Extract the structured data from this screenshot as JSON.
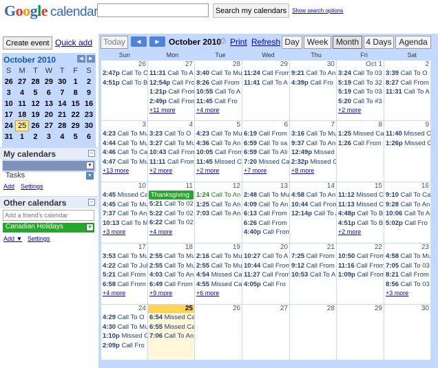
{
  "header": {
    "logo_google": "Google",
    "logo_calendar": "calendar",
    "search_placeholder": "",
    "search_button": "Search my calendars",
    "search_options": "Show search options"
  },
  "sidebar": {
    "create_event": "Create event",
    "quick_add": "Quick add",
    "mini_month": "October 2010",
    "weekday_headers": [
      "S",
      "M",
      "T",
      "W",
      "T",
      "F",
      "S"
    ],
    "mini_weeks": [
      [
        "26",
        "27",
        "28",
        "29",
        "30",
        "1",
        "2"
      ],
      [
        "3",
        "4",
        "5",
        "6",
        "7",
        "8",
        "9"
      ],
      [
        "10",
        "11",
        "12",
        "13",
        "14",
        "15",
        "16"
      ],
      [
        "17",
        "18",
        "19",
        "20",
        "21",
        "22",
        "23"
      ],
      [
        "24",
        "25",
        "26",
        "27",
        "28",
        "29",
        "30"
      ],
      [
        "31",
        "1",
        "2",
        "3",
        "4",
        "5",
        "6"
      ]
    ],
    "my_calendars_title": "My calendars",
    "tasks_label": "Tasks",
    "add_link": "Add",
    "settings_link": "Settings",
    "other_calendars_title": "Other calendars",
    "friend_placeholder": "Add a friend's calendar",
    "canadian_holidays": "Canadian Holidays",
    "add_menu_link": "Add ▼",
    "settings_link2": "Settings",
    "colors": {
      "holiday": "#28a52d",
      "mycal": "#7f93b8"
    }
  },
  "toolbar": {
    "today": "Today",
    "prev_icon": "◀",
    "next_icon": "▶",
    "current_month": "October 2010",
    "print": "Print",
    "refresh": "Refresh",
    "views": [
      "Day",
      "Week",
      "Month",
      "4 Days",
      "Agenda"
    ],
    "selected_view": "Month"
  },
  "grid": {
    "days_of_week": [
      "Sun",
      "Mon",
      "Tue",
      "Wed",
      "Thu",
      "Fri",
      "Sat"
    ],
    "weeks": [
      [
        {
          "day": "26",
          "events": [
            {
              "t": "2:47p",
              "x": "Call To O"
            },
            {
              "t": "4:51p",
              "x": "Call To B"
            }
          ]
        },
        {
          "day": "27",
          "events": [
            {
              "t": "11:31",
              "x": "Call To A"
            },
            {
              "t": "12:54p",
              "x": "Call Fro"
            },
            {
              "t": "1:21p",
              "x": "Call From"
            },
            {
              "t": "2:49p",
              "x": "Call From"
            }
          ],
          "more": "+11 more"
        },
        {
          "day": "28",
          "events": [
            {
              "t": "3:40",
              "x": "Call To Mu"
            },
            {
              "t": "8:26",
              "x": "Call From"
            },
            {
              "t": "10:55",
              "x": "Call To A"
            },
            {
              "t": "11:45",
              "x": "Call Fro"
            }
          ],
          "more": "+4 more"
        },
        {
          "day": "29",
          "events": [
            {
              "t": "11:24",
              "x": "Call From"
            },
            {
              "t": "11:41",
              "x": "Call To A"
            }
          ]
        },
        {
          "day": "30",
          "events": [
            {
              "t": "9:21",
              "x": "Call To An"
            },
            {
              "t": "4:39p",
              "x": "Call Fro"
            }
          ]
        },
        {
          "day": "Oct 1",
          "events": [
            {
              "t": "3:24",
              "x": "Call To 03"
            },
            {
              "t": "5:19",
              "x": "Call To 32"
            },
            {
              "t": "5:19",
              "x": "Call To 03"
            },
            {
              "t": "5:20",
              "x": "Call To #3"
            }
          ],
          "more": "+2 more"
        },
        {
          "day": "2",
          "events": [
            {
              "t": "3:39",
              "x": "Call To O"
            },
            {
              "t": "8:27",
              "x": "Call From"
            },
            {
              "t": "11:31",
              "x": "Call To A"
            }
          ]
        }
      ],
      [
        {
          "day": "3",
          "events": [
            {
              "t": "4:23",
              "x": "Call To Mu"
            },
            {
              "t": "4:44",
              "x": "Call To Mu"
            },
            {
              "t": "4:46",
              "x": "Call To Ca"
            },
            {
              "t": "4:47",
              "x": "Call To Mu"
            }
          ],
          "more": "+13 more"
        },
        {
          "day": "4",
          "events": [
            {
              "t": "3:23",
              "x": "Call To O"
            },
            {
              "t": "3:27",
              "x": "Call To Mu"
            },
            {
              "t": "10:43",
              "x": "Call From"
            },
            {
              "t": "11:11",
              "x": "Call From"
            }
          ],
          "more": "+2 more"
        },
        {
          "day": "5",
          "events": [
            {
              "t": "4:23",
              "x": "Call To Mu"
            },
            {
              "t": "4:36",
              "x": "Call To An"
            },
            {
              "t": "10:05",
              "x": "Call From"
            },
            {
              "t": "11:45",
              "x": "Missed Ca"
            }
          ],
          "more": "+2 more"
        },
        {
          "day": "6",
          "events": [
            {
              "t": "6:19",
              "x": "Call From"
            },
            {
              "t": "6:59",
              "x": "Call To sa"
            },
            {
              "t": "6:59",
              "x": "Call To Ali"
            },
            {
              "t": "7:20",
              "x": "Missed Ca"
            }
          ],
          "more": "+7 more"
        },
        {
          "day": "7",
          "events": [
            {
              "t": "3:16",
              "x": "Call To Mu"
            },
            {
              "t": "9:37",
              "x": "Call To An"
            },
            {
              "t": "12:49p",
              "x": "Missed C"
            },
            {
              "t": "2:32p",
              "x": "Missed Ca"
            }
          ],
          "more": "+8 more"
        },
        {
          "day": "8",
          "events": [
            {
              "t": "1:25",
              "x": "Missed Ca"
            },
            {
              "t": "1:26",
              "x": "Call From"
            }
          ]
        },
        {
          "day": "9",
          "events": [
            {
              "t": "11:40",
              "x": "Missed C"
            },
            {
              "t": "1:26p",
              "x": "Missed C"
            }
          ]
        }
      ],
      [
        {
          "day": "10",
          "events": [
            {
              "t": "4:45",
              "x": "Missed Ca"
            },
            {
              "t": "4:45",
              "x": "Call To Mu"
            },
            {
              "t": "7:37",
              "x": "Call To An"
            },
            {
              "t": "10:13",
              "x": "Call To Mi"
            }
          ],
          "more": "+3 more"
        },
        {
          "day": "11",
          "allday": "Thanksgiving",
          "events": [
            {
              "t": "5:21",
              "x": "Call To 02"
            },
            {
              "t": "5:22",
              "x": "Call To 02"
            },
            {
              "t": "6:22",
              "x": "Call To 02"
            }
          ],
          "more": "+4 more"
        },
        {
          "day": "12",
          "events": [
            {
              "t": "1:24",
              "x": "Call To An",
              "g": true
            },
            {
              "t": "1:25",
              "x": "Call To An"
            },
            {
              "t": "7:03",
              "x": "Call To An"
            }
          ]
        },
        {
          "day": "13",
          "events": [
            {
              "t": "2:48",
              "x": "Call To Mu"
            },
            {
              "t": "4:09",
              "x": "Call To An"
            },
            {
              "t": "6:13",
              "x": "Call From"
            },
            {
              "t": "6:26",
              "x": "Call From"
            },
            {
              "t": "4:40p",
              "x": "Call From"
            }
          ]
        },
        {
          "day": "14",
          "events": [
            {
              "t": "4:58",
              "x": "Call To An"
            },
            {
              "t": "10:44",
              "x": "Call From"
            },
            {
              "t": "12:14p",
              "x": "Call To A"
            }
          ]
        },
        {
          "day": "15",
          "events": [
            {
              "t": "11:12",
              "x": "Missed C"
            },
            {
              "t": "11:13",
              "x": "Missed C"
            },
            {
              "t": "4:48p",
              "x": "Call To B"
            },
            {
              "t": "4:51p",
              "x": "Call To B"
            }
          ],
          "more": "+2 more"
        },
        {
          "day": "16",
          "events": [
            {
              "t": "9:10",
              "x": "Call To Ca"
            },
            {
              "t": "9:28",
              "x": "Call To An"
            },
            {
              "t": "10:06",
              "x": "Call To An"
            },
            {
              "t": "5:02p",
              "x": "Call Fro"
            }
          ]
        }
      ],
      [
        {
          "day": "17",
          "events": [
            {
              "t": "3:53",
              "x": "Call To Mu"
            },
            {
              "t": "4:22",
              "x": "Call To Jul"
            },
            {
              "t": "5:21",
              "x": "Call From"
            },
            {
              "t": "6:58",
              "x": "Call From"
            }
          ],
          "more": "+4 more"
        },
        {
          "day": "18",
          "events": [
            {
              "t": "2:55",
              "x": "Call To Mu"
            },
            {
              "t": "2:55",
              "x": "Call To Mu"
            },
            {
              "t": "4:03",
              "x": "Call To An"
            },
            {
              "t": "6:49",
              "x": "Call From"
            }
          ],
          "more": "+9 more"
        },
        {
          "day": "19",
          "events": [
            {
              "t": "2:16",
              "x": "Call To Mu"
            },
            {
              "t": "2:55",
              "x": "Call To Mu"
            },
            {
              "t": "4:54",
              "x": "Missed Ca"
            },
            {
              "t": "4:55",
              "x": "Missed Ca"
            }
          ],
          "more": "+6 more"
        },
        {
          "day": "20",
          "events": [
            {
              "t": "10:27",
              "x": "Call To A"
            },
            {
              "t": "10:44",
              "x": "Call From"
            },
            {
              "t": "11:27",
              "x": "Call From"
            },
            {
              "t": "4:05p",
              "x": "Call Fro"
            }
          ]
        },
        {
          "day": "21",
          "events": [
            {
              "t": "7:25",
              "x": "Call From"
            },
            {
              "t": "9:12",
              "x": "Call From"
            },
            {
              "t": "10:53",
              "x": "Call To A"
            }
          ]
        },
        {
          "day": "22",
          "events": [
            {
              "t": "10:50",
              "x": "Call From"
            },
            {
              "t": "11:16",
              "x": "Call From"
            },
            {
              "t": "1:09p",
              "x": "Call From"
            }
          ]
        },
        {
          "day": "23",
          "events": [
            {
              "t": "4:58",
              "x": "Call To Mu"
            },
            {
              "t": "7:05",
              "x": "Call To 03"
            },
            {
              "t": "8:21",
              "x": "Call From"
            },
            {
              "t": "8:56",
              "x": "Call To 03"
            }
          ],
          "more": "+3 more"
        }
      ],
      [
        {
          "day": "24",
          "events": [
            {
              "t": "4:29",
              "x": "Call To O"
            },
            {
              "t": "4:30",
              "x": "Call To Mu"
            },
            {
              "t": "1:10p",
              "x": "Missed C"
            },
            {
              "t": "2:09p",
              "x": "Call Fro"
            }
          ]
        },
        {
          "day": "25",
          "today": true,
          "events": [
            {
              "t": "6:54",
              "x": "Missed Ca"
            },
            {
              "t": "6:55",
              "x": "Missed Ca"
            },
            {
              "t": "7:06",
              "x": "Call To An"
            }
          ]
        },
        {
          "day": "26",
          "events": []
        },
        {
          "day": "27",
          "events": []
        },
        {
          "day": "28",
          "events": []
        },
        {
          "day": "29",
          "events": []
        },
        {
          "day": "30",
          "events": []
        }
      ]
    ]
  }
}
